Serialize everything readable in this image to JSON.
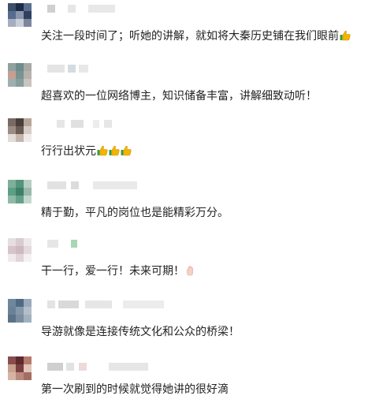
{
  "comments": [
    {
      "text": "关注一段时间了；听她的讲解，就如将大秦历史铺在我们眼前",
      "emojis": [
        "thumbs-up"
      ],
      "avatar_colors": [
        "#3e4f6b",
        "#1c2b4a",
        "#5a6d8e",
        "#556b8f",
        "#8b97ad",
        "#30405f",
        "#a5aebf",
        "#c9ced8",
        "#7c879c"
      ]
    },
    {
      "text": "超喜欢的一位网络博主，知识储备丰富，讲解细致动听！",
      "emojis": [],
      "avatar_colors": [
        "#8ea2a0",
        "#6f8b8d",
        "#a6a9a4",
        "#c79f92",
        "#7a9391",
        "#b8b2ac",
        "#9db0b0",
        "#869e9c",
        "#c8c4be"
      ]
    },
    {
      "text": "行行出状元",
      "emojis": [
        "thumbs-up",
        "thumbs-up",
        "thumbs-up"
      ],
      "avatar_colors": [
        "#7a6a64",
        "#4a3f3c",
        "#b7a59b",
        "#9c8c85",
        "#6b5b55",
        "#d7cdc6",
        "#e2dbd6",
        "#c4b6ae",
        "#f0ebe8"
      ]
    },
    {
      "text": "精于勤，平凡的岗位也是能精彩万分。",
      "emojis": [],
      "avatar_colors": [
        "#7fae9a",
        "#54947c",
        "#b6cfc4",
        "#5d9f86",
        "#3e7f68",
        "#9ab8ad",
        "#8fb9a6",
        "#67a08a",
        "#c5d8d0"
      ]
    },
    {
      "text": "干一行，爱一行！未来可期！",
      "emojis": [
        "raised-hand"
      ],
      "avatar_colors": [
        "#e7dee0",
        "#d9ccd0",
        "#eee8ea",
        "#d5c4c9",
        "#cdb9bf",
        "#e4d9dc",
        "#f0eaec",
        "#e1d5d8",
        "#f5f0f2"
      ]
    },
    {
      "text": "导游就像是连接传统文化和公众的桥梁！",
      "emojis": [],
      "avatar_colors": [
        "#6f879c",
        "#4f6a82",
        "#9aaabb",
        "#6b8296",
        "#8598aa",
        "#b2bfcb",
        "#5b7388",
        "#7b8ea1",
        "#a3b1bf"
      ]
    },
    {
      "text": "第一次刷到的时候就觉得她讲的很好滴",
      "emojis": [],
      "avatar_colors": [
        "#8a4d4d",
        "#5f2a2e",
        "#b57a6d",
        "#c9a08f",
        "#7a3f41",
        "#e0c5b8",
        "#d6b3a3",
        "#b88a7e",
        "#a46d64"
      ]
    }
  ],
  "colors": {
    "text": "#222222",
    "name_placeholder": "#e3e3e3"
  }
}
